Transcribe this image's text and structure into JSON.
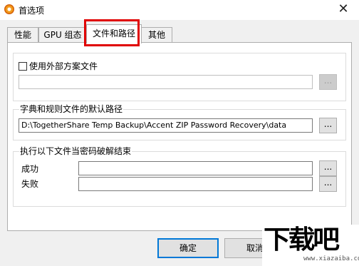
{
  "window": {
    "title": "首选项",
    "close_glyph": "✕",
    "icon": "app-orange-gear-icon"
  },
  "tabs": [
    {
      "label": "性能",
      "active": false
    },
    {
      "label": "GPU 组态",
      "active": false
    },
    {
      "label": "文件和路径",
      "active": true
    },
    {
      "label": "其他",
      "active": false
    }
  ],
  "external_scheme": {
    "checkbox_label": "使用外部方案文件",
    "checked": false,
    "path_value": "",
    "browse_label": "..."
  },
  "dict_path": {
    "group_title": "字典和规则文件的默认路径",
    "path_value": "D:\\TogetherShare Temp Backup\\Accent ZIP Password Recovery\\data",
    "browse_label": "..."
  },
  "on_finish": {
    "group_title": "执行以下文件当密码破解结束",
    "success_label": "成功",
    "success_value": "",
    "fail_label": "失败",
    "fail_value": "",
    "browse_label": "..."
  },
  "footer": {
    "ok_label": "确定",
    "cancel_label": "取消"
  },
  "watermark": {
    "logo": "下载吧",
    "url": "www.xiazaiba.com"
  },
  "colors": {
    "highlight": "#e00000",
    "default_button_border": "#0078d7"
  }
}
